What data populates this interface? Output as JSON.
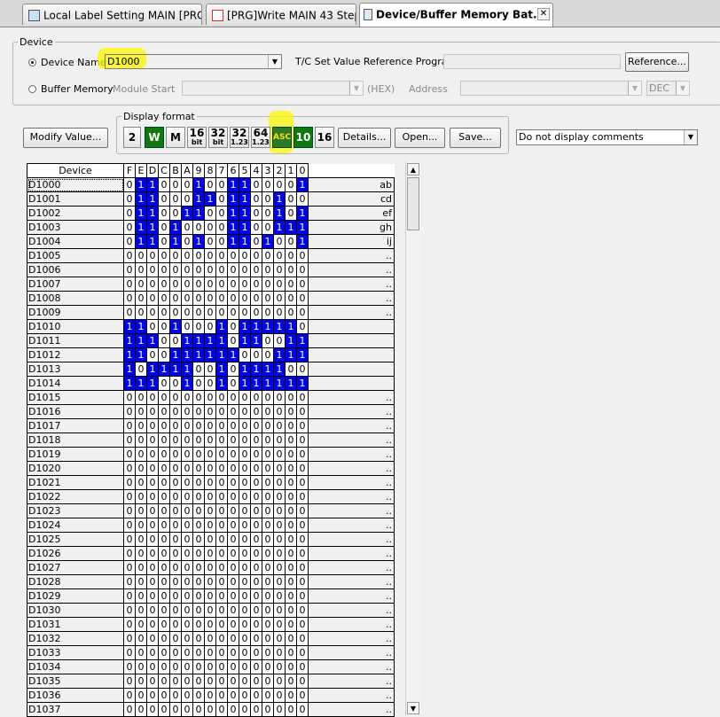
{
  "tabs": [
    {
      "label": "Local Label Setting MAIN [PRG]",
      "active": false
    },
    {
      "label": "[PRG]Write MAIN 43 Step",
      "active": false
    },
    {
      "label": "Device/Buffer Memory Bat...",
      "active": true
    }
  ],
  "device_group": {
    "title": "Device",
    "device_name_label": "Device Name",
    "device_name_value": "D1000",
    "tc_label": "T/C Set Value Reference Program",
    "reference_button": "Reference...",
    "buffer_memory_label": "Buffer Memory",
    "module_start_label": "Module Start",
    "hex_label": "(HEX)",
    "address_label": "Address",
    "address_format": "DEC"
  },
  "display_format": {
    "title": "Display format",
    "buttons": [
      {
        "name": "2-bit-button",
        "label": "2"
      },
      {
        "name": "word-button",
        "label": "W"
      },
      {
        "name": "m-button",
        "label": "M"
      },
      {
        "name": "16bit-button",
        "label": "16",
        "sub": "bit"
      },
      {
        "name": "32bit-button",
        "label": "32",
        "sub": "bit"
      },
      {
        "name": "32real-button",
        "label": "32",
        "sub": "1.23"
      },
      {
        "name": "64real-button",
        "label": "64",
        "sub": "1.23"
      },
      {
        "name": "asc-button",
        "label": "ASC"
      },
      {
        "name": "dec-button",
        "label": "10"
      },
      {
        "name": "hex-button",
        "label": "16"
      }
    ],
    "details": "Details...",
    "open": "Open...",
    "save": "Save..."
  },
  "modify_value": "Modify Value...",
  "comment_select": "Do not display comments",
  "grid": {
    "device_header": "Device",
    "bit_headers": [
      "F",
      "E",
      "D",
      "C",
      "B",
      "A",
      "9",
      "8",
      "7",
      "6",
      "5",
      "4",
      "3",
      "2",
      "1",
      "0"
    ],
    "rows": [
      {
        "device": "D1000",
        "bits": "0110001001100001",
        "asc": "ab"
      },
      {
        "device": "D1001",
        "bits": "0110001101100100",
        "asc": "cd"
      },
      {
        "device": "D1002",
        "bits": "0110011001100101",
        "asc": "ef"
      },
      {
        "device": "D1003",
        "bits": "0110100001100111",
        "asc": "gh"
      },
      {
        "device": "D1004",
        "bits": "0110101001101001",
        "asc": "ij"
      },
      {
        "device": "D1005",
        "bits": "0000000000000000",
        "asc": ".."
      },
      {
        "device": "D1006",
        "bits": "0000000000000000",
        "asc": ".."
      },
      {
        "device": "D1007",
        "bits": "0000000000000000",
        "asc": ".."
      },
      {
        "device": "D1008",
        "bits": "0000000000000000",
        "asc": ".."
      },
      {
        "device": "D1009",
        "bits": "0000000000000000",
        "asc": ".."
      },
      {
        "device": "D1010",
        "bits": "1100100010111110",
        "asc": ""
      },
      {
        "device": "D1011",
        "bits": "1110011110110011",
        "asc": ""
      },
      {
        "device": "D1012",
        "bits": "1100111111000111",
        "asc": ""
      },
      {
        "device": "D1013",
        "bits": "1011110010111100",
        "asc": ""
      },
      {
        "device": "D1014",
        "bits": "1110010010111111",
        "asc": ""
      },
      {
        "device": "D1015",
        "bits": "0000000000000000",
        "asc": ".."
      },
      {
        "device": "D1016",
        "bits": "0000000000000000",
        "asc": ".."
      },
      {
        "device": "D1017",
        "bits": "0000000000000000",
        "asc": ".."
      },
      {
        "device": "D1018",
        "bits": "0000000000000000",
        "asc": ".."
      },
      {
        "device": "D1019",
        "bits": "0000000000000000",
        "asc": ".."
      },
      {
        "device": "D1020",
        "bits": "0000000000000000",
        "asc": ".."
      },
      {
        "device": "D1021",
        "bits": "0000000000000000",
        "asc": ".."
      },
      {
        "device": "D1022",
        "bits": "0000000000000000",
        "asc": ".."
      },
      {
        "device": "D1023",
        "bits": "0000000000000000",
        "asc": ".."
      },
      {
        "device": "D1024",
        "bits": "0000000000000000",
        "asc": ".."
      },
      {
        "device": "D1025",
        "bits": "0000000000000000",
        "asc": ".."
      },
      {
        "device": "D1026",
        "bits": "0000000000000000",
        "asc": ".."
      },
      {
        "device": "D1027",
        "bits": "0000000000000000",
        "asc": ".."
      },
      {
        "device": "D1028",
        "bits": "0000000000000000",
        "asc": ".."
      },
      {
        "device": "D1029",
        "bits": "0000000000000000",
        "asc": ".."
      },
      {
        "device": "D1030",
        "bits": "0000000000000000",
        "asc": ".."
      },
      {
        "device": "D1031",
        "bits": "0000000000000000",
        "asc": ".."
      },
      {
        "device": "D1032",
        "bits": "0000000000000000",
        "asc": ".."
      },
      {
        "device": "D1033",
        "bits": "0000000000000000",
        "asc": ".."
      },
      {
        "device": "D1034",
        "bits": "0000000000000000",
        "asc": ".."
      },
      {
        "device": "D1035",
        "bits": "0000000000000000",
        "asc": ".."
      },
      {
        "device": "D1036",
        "bits": "0000000000000000",
        "asc": ".."
      },
      {
        "device": "D1037",
        "bits": "0000000000000000",
        "asc": ".."
      }
    ]
  },
  "colors": {
    "bit_on": "#0000e8",
    "highlight": "#fff500",
    "green_button": "#117711"
  }
}
